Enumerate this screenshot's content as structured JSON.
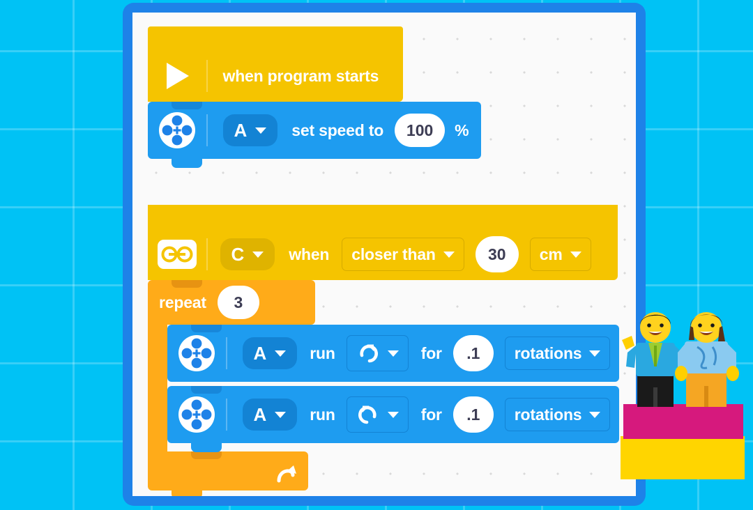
{
  "app": {
    "title": "LEGO Education SPIKE word-block program canvas",
    "colors": {
      "background": "#00C2F5",
      "canvas_frame": "#1E82E8",
      "canvas": "#FAFAFA",
      "event_yellow": "#F5C400",
      "control_orange": "#FFAB19",
      "motor_blue": "#1E9CF0"
    }
  },
  "program": {
    "blocks": [
      {
        "id": "when-program-starts",
        "kind": "hat",
        "icon": "play-icon",
        "label": "when program starts"
      },
      {
        "id": "set-speed",
        "kind": "motor",
        "icon": "motor-icon",
        "port": "A",
        "label": "set speed to",
        "value": "100",
        "unit": "%"
      },
      {
        "id": "when-distance",
        "kind": "hat-sensor",
        "icon": "distance-sensor-icon",
        "port": "C",
        "label": "when",
        "condition": "closer than",
        "value": "30",
        "unit": "cm"
      },
      {
        "id": "repeat",
        "kind": "control",
        "label": "repeat",
        "value": "3",
        "loop_icon": "loop-arrow-icon"
      },
      {
        "id": "run-clockwise",
        "kind": "motor",
        "icon": "motor-icon",
        "port": "A",
        "label_run": "run",
        "direction_icon": "clockwise-arrow-icon",
        "label_for": "for",
        "value": ".1",
        "unit": "rotations"
      },
      {
        "id": "run-counterclockwise",
        "kind": "motor",
        "icon": "motor-icon",
        "port": "A",
        "label_run": "run",
        "direction_icon": "counterclockwise-arrow-icon",
        "label_for": "for",
        "value": ".1",
        "unit": "rotations"
      }
    ]
  },
  "decoration": {
    "minifigures": {
      "name": "lego-minifigures",
      "count": "2",
      "base_bricks": [
        "magenta",
        "yellow"
      ]
    }
  }
}
